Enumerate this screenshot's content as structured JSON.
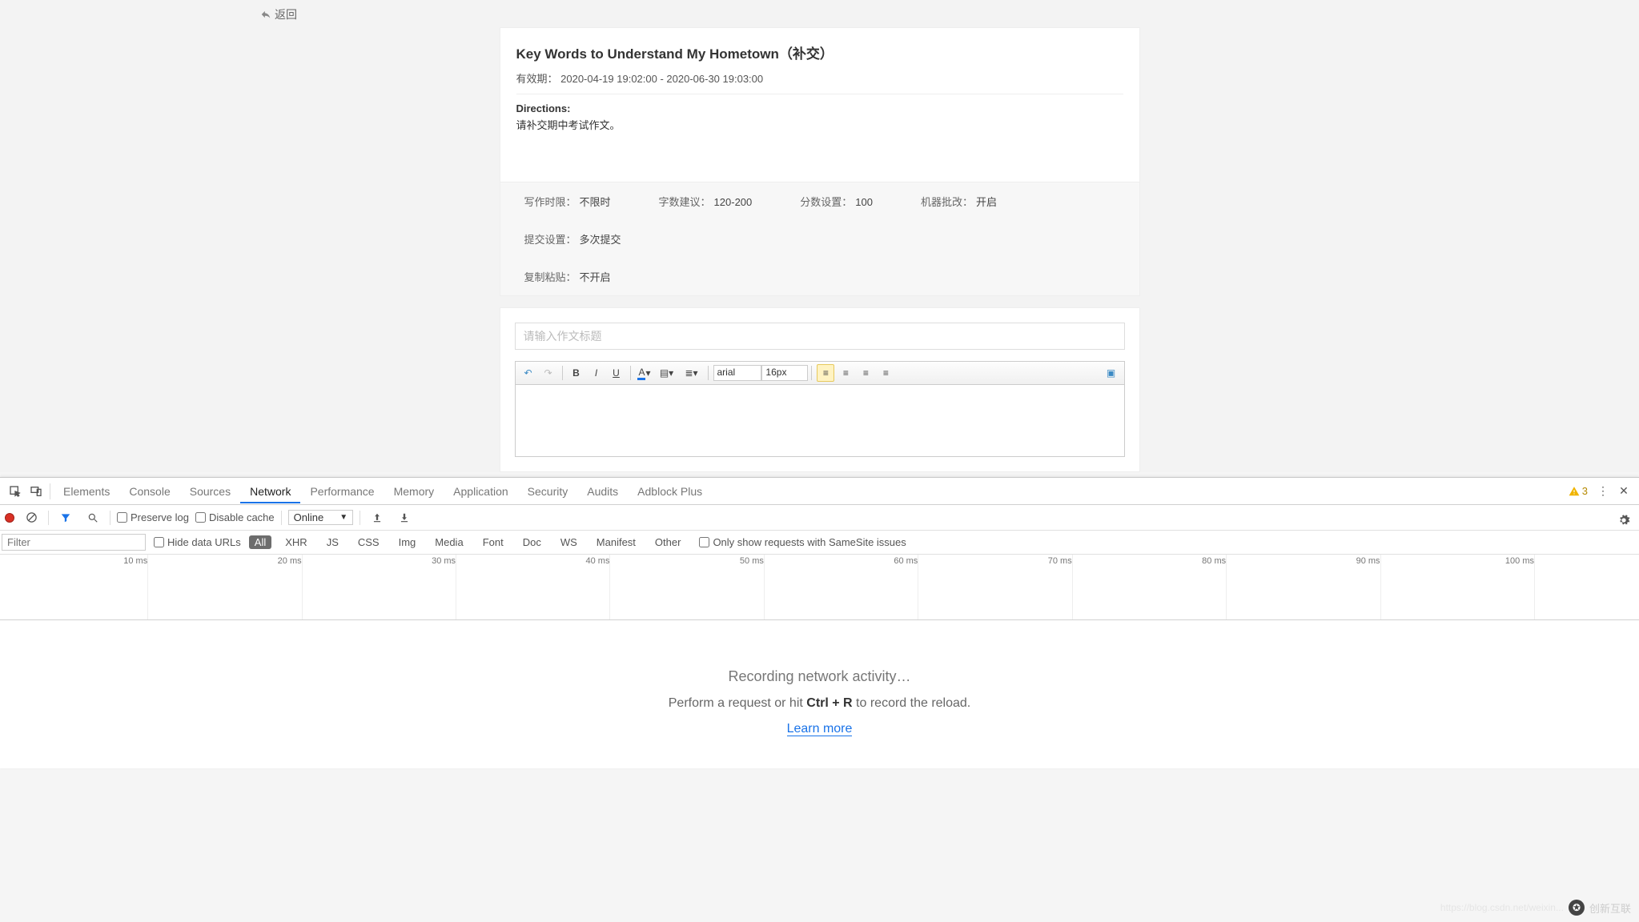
{
  "app": {
    "back_label": "返回",
    "assignment_title": "Key Words to Understand My Hometown（补交）",
    "validity_label": "有效期：",
    "validity_range": "2020-04-19 19:02:00 - 2020-06-30 19:03:00",
    "directions_label": "Directions:",
    "directions_text": "请补交期中考试作文。",
    "settings": [
      {
        "k": "写作时限：",
        "v": "不限时"
      },
      {
        "k": "字数建议：",
        "v": "120-200"
      },
      {
        "k": "分数设置：",
        "v": "100"
      },
      {
        "k": "机器批改：",
        "v": "开启"
      },
      {
        "k": "提交设置：",
        "v": "多次提交"
      },
      {
        "k": "复制粘贴：",
        "v": "不开启"
      }
    ],
    "title_placeholder": "请输入作文标题",
    "rte": {
      "font_family": "arial",
      "font_size": "16px"
    }
  },
  "devtools": {
    "tabs": [
      "Elements",
      "Console",
      "Sources",
      "Network",
      "Performance",
      "Memory",
      "Application",
      "Security",
      "Audits",
      "Adblock Plus"
    ],
    "active_tab": "Network",
    "warning_count": "3",
    "preserve_log": "Preserve log",
    "disable_cache": "Disable cache",
    "throttling": "Online",
    "filter_placeholder": "Filter",
    "hide_data_urls": "Hide data URLs",
    "chips": [
      "All",
      "XHR",
      "JS",
      "CSS",
      "Img",
      "Media",
      "Font",
      "Doc",
      "WS",
      "Manifest",
      "Other"
    ],
    "active_chip": "All",
    "samesite_label": "Only show requests with SameSite issues",
    "timeline_ticks": [
      "10 ms",
      "20 ms",
      "30 ms",
      "40 ms",
      "50 ms",
      "60 ms",
      "70 ms",
      "80 ms",
      "90 ms",
      "100 ms"
    ],
    "empty": {
      "line1": "Recording network activity…",
      "line2_pre": "Perform a request or hit ",
      "shortcut": "Ctrl + R",
      "line2_post": " to record the reload.",
      "learn_more": "Learn more"
    }
  },
  "watermark": {
    "url": "https://blog.csdn.net/weixin...",
    "brand": "创新互联"
  }
}
